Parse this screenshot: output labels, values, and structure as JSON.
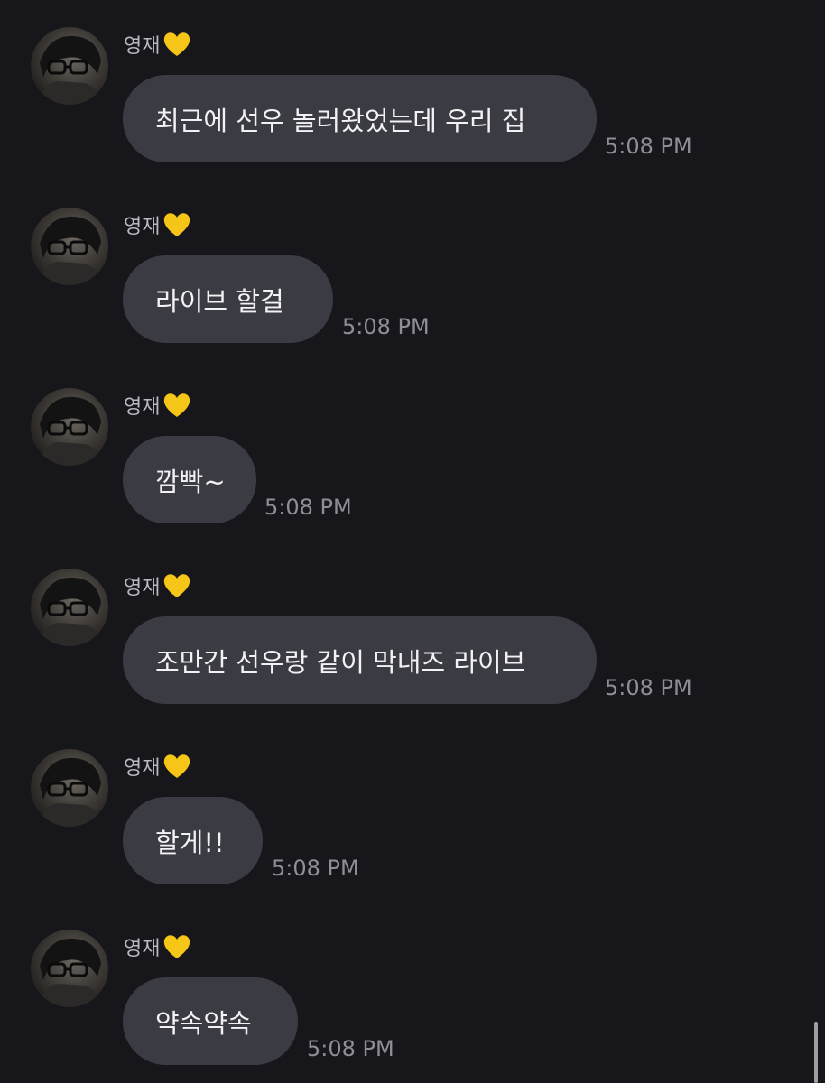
{
  "messages": [
    {
      "sender": "영재",
      "heart": "yellow-heart-icon",
      "text": "최근에 선우 놀러왔었는데 우리 집",
      "time": "5:08 PM"
    },
    {
      "sender": "영재",
      "heart": "yellow-heart-icon",
      "text": "라이브 할걸",
      "time": "5:08 PM"
    },
    {
      "sender": "영재",
      "heart": "yellow-heart-icon",
      "text": "깜빡~",
      "time": "5:08 PM"
    },
    {
      "sender": "영재",
      "heart": "yellow-heart-icon",
      "text": "조만간 선우랑 같이 막내즈 라이브",
      "time": "5:08 PM"
    },
    {
      "sender": "영재",
      "heart": "yellow-heart-icon",
      "text": "할게!!",
      "time": "5:08 PM"
    },
    {
      "sender": "영재",
      "heart": "yellow-heart-icon",
      "text": "약속약속",
      "time": "5:08 PM"
    }
  ],
  "colors": {
    "background": "#17171b",
    "bubble": "#3b3b43",
    "text": "#f2f2f4",
    "timestamp": "#8e8e94",
    "sender": "#b9b9bf",
    "heart": "#f5c518"
  }
}
